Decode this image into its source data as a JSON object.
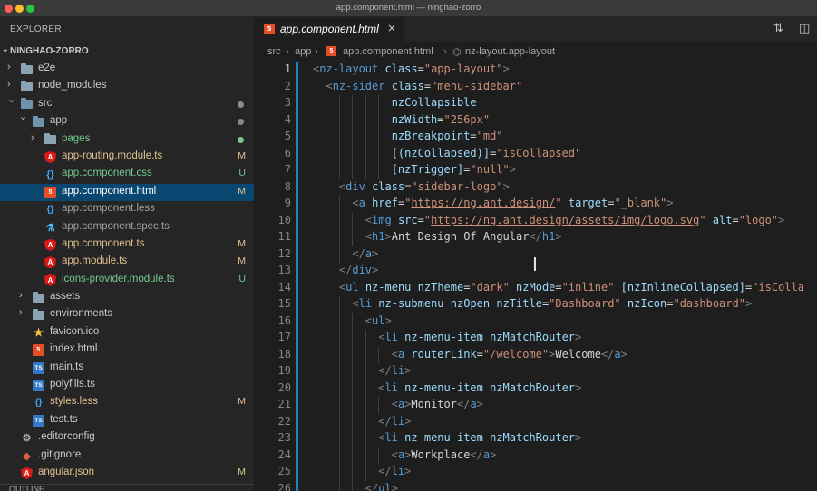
{
  "window": {
    "title": "app.component.html — ninghao-zorro"
  },
  "sidebar": {
    "title": "EXPLORER",
    "project": "NINGHAO-ZORRO",
    "outline_label": "OUTLINE",
    "tree": [
      {
        "name": "e2e",
        "kind": "folder",
        "open": false,
        "depth": 0
      },
      {
        "name": "node_modules",
        "kind": "folder",
        "open": false,
        "depth": 0
      },
      {
        "name": "src",
        "kind": "folder",
        "open": true,
        "depth": 0,
        "dot": "#8a8a8a",
        "name_color": "#cccccc"
      },
      {
        "name": "app",
        "kind": "folder",
        "open": true,
        "depth": 1,
        "dot": "#8a8a8a"
      },
      {
        "name": "pages",
        "kind": "folder",
        "open": false,
        "depth": 2,
        "dot": "#73c991",
        "name_color": "#73c991"
      },
      {
        "name": "app-routing.module.ts",
        "kind": "angular",
        "depth": 2,
        "status": "M",
        "name_color": "#e2c08d"
      },
      {
        "name": "app.component.css",
        "kind": "css",
        "depth": 2,
        "status": "U",
        "name_color": "#73c991"
      },
      {
        "name": "app.component.html",
        "kind": "html",
        "depth": 2,
        "status": "M",
        "selected": true,
        "name_color": "#ffffff"
      },
      {
        "name": "app.component.less",
        "kind": "less",
        "depth": 2,
        "name_color": "#a0a0a0"
      },
      {
        "name": "app.component.spec.ts",
        "kind": "spec",
        "depth": 2,
        "name_color": "#a0a0a0"
      },
      {
        "name": "app.component.ts",
        "kind": "angular",
        "depth": 2,
        "status": "M",
        "name_color": "#e2c08d"
      },
      {
        "name": "app.module.ts",
        "kind": "angular",
        "depth": 2,
        "status": "M",
        "name_color": "#e2c08d"
      },
      {
        "name": "icons-provider.module.ts",
        "kind": "angular",
        "depth": 2,
        "status": "U",
        "name_color": "#73c991"
      },
      {
        "name": "assets",
        "kind": "folder",
        "open": false,
        "depth": 1
      },
      {
        "name": "environments",
        "kind": "folder",
        "open": false,
        "depth": 1
      },
      {
        "name": "favicon.ico",
        "kind": "star",
        "depth": 1
      },
      {
        "name": "index.html",
        "kind": "html",
        "depth": 1
      },
      {
        "name": "main.ts",
        "kind": "ts",
        "depth": 1
      },
      {
        "name": "polyfills.ts",
        "kind": "ts",
        "depth": 1
      },
      {
        "name": "styles.less",
        "kind": "less",
        "depth": 1,
        "status": "M",
        "name_color": "#e2c08d"
      },
      {
        "name": "test.ts",
        "kind": "ts",
        "depth": 1
      },
      {
        "name": ".editorconfig",
        "kind": "editor",
        "depth": 0
      },
      {
        "name": ".gitignore",
        "kind": "git",
        "depth": 0
      },
      {
        "name": "angular.json",
        "kind": "angular",
        "depth": 0,
        "status": "M",
        "name_color": "#e2c08d"
      }
    ]
  },
  "editor": {
    "tab": {
      "label": "app.component.html",
      "close": "×"
    },
    "breadcrumb": [
      "src",
      "app",
      "app.component.html",
      "nz-layout.app-layout"
    ],
    "lines": [
      [
        [
          "t-punc",
          "<"
        ],
        [
          "t-tag",
          "nz-layout"
        ],
        [
          "t-text",
          " "
        ],
        [
          "t-attr",
          "class"
        ],
        [
          "t-eq",
          "="
        ],
        [
          "t-str",
          "\"app-layout\""
        ],
        [
          "t-punc",
          ">"
        ]
      ],
      [
        [
          "t-text",
          "  "
        ],
        [
          "t-punc",
          "<"
        ],
        [
          "t-tag",
          "nz-sider"
        ],
        [
          "t-text",
          " "
        ],
        [
          "t-attr",
          "class"
        ],
        [
          "t-eq",
          "="
        ],
        [
          "t-str",
          "\"menu-sidebar\""
        ]
      ],
      [
        [
          "t-text",
          "            "
        ],
        [
          "t-attr",
          "nzCollapsible"
        ]
      ],
      [
        [
          "t-text",
          "            "
        ],
        [
          "t-attr",
          "nzWidth"
        ],
        [
          "t-eq",
          "="
        ],
        [
          "t-str",
          "\"256px\""
        ]
      ],
      [
        [
          "t-text",
          "            "
        ],
        [
          "t-attr",
          "nzBreakpoint"
        ],
        [
          "t-eq",
          "="
        ],
        [
          "t-str",
          "\"md\""
        ]
      ],
      [
        [
          "t-text",
          "            "
        ],
        [
          "t-attr",
          "[(nzCollapsed)]"
        ],
        [
          "t-eq",
          "="
        ],
        [
          "t-str",
          "\"isCollapsed\""
        ]
      ],
      [
        [
          "t-text",
          "            "
        ],
        [
          "t-attr",
          "[nzTrigger]"
        ],
        [
          "t-eq",
          "="
        ],
        [
          "t-str",
          "\"null\""
        ],
        [
          "t-punc",
          ">"
        ]
      ],
      [
        [
          "t-text",
          "    "
        ],
        [
          "t-punc",
          "<"
        ],
        [
          "t-tag",
          "div"
        ],
        [
          "t-text",
          " "
        ],
        [
          "t-attr",
          "class"
        ],
        [
          "t-eq",
          "="
        ],
        [
          "t-str",
          "\"sidebar-logo\""
        ],
        [
          "t-punc",
          ">"
        ]
      ],
      [
        [
          "t-text",
          "      "
        ],
        [
          "t-punc",
          "<"
        ],
        [
          "t-tag",
          "a"
        ],
        [
          "t-text",
          " "
        ],
        [
          "t-attr",
          "href"
        ],
        [
          "t-eq",
          "="
        ],
        [
          "t-str",
          "\""
        ],
        [
          "t-url",
          "https://ng.ant.design/"
        ],
        [
          "t-str",
          "\""
        ],
        [
          "t-text",
          " "
        ],
        [
          "t-attr",
          "target"
        ],
        [
          "t-eq",
          "="
        ],
        [
          "t-str",
          "\"_blank\""
        ],
        [
          "t-punc",
          ">"
        ]
      ],
      [
        [
          "t-text",
          "        "
        ],
        [
          "t-punc",
          "<"
        ],
        [
          "t-tag",
          "img"
        ],
        [
          "t-text",
          " "
        ],
        [
          "t-attr",
          "src"
        ],
        [
          "t-eq",
          "="
        ],
        [
          "t-str",
          "\""
        ],
        [
          "t-url",
          "https://ng.ant.design/assets/img/logo.svg"
        ],
        [
          "t-str",
          "\""
        ],
        [
          "t-text",
          " "
        ],
        [
          "t-attr",
          "alt"
        ],
        [
          "t-eq",
          "="
        ],
        [
          "t-str",
          "\"logo\""
        ],
        [
          "t-punc",
          ">"
        ]
      ],
      [
        [
          "t-text",
          "        "
        ],
        [
          "t-punc",
          "<"
        ],
        [
          "t-tag",
          "h1"
        ],
        [
          "t-punc",
          ">"
        ],
        [
          "t-text",
          "Ant Design Of Angular"
        ],
        [
          "t-punc",
          "</"
        ],
        [
          "t-tag",
          "h1"
        ],
        [
          "t-punc",
          ">"
        ]
      ],
      [
        [
          "t-text",
          "      "
        ],
        [
          "t-punc",
          "</"
        ],
        [
          "t-tag",
          "a"
        ],
        [
          "t-punc",
          ">"
        ]
      ],
      [
        [
          "t-text",
          "    "
        ],
        [
          "t-punc",
          "</"
        ],
        [
          "t-tag",
          "div"
        ],
        [
          "t-punc",
          ">"
        ]
      ],
      [
        [
          "t-text",
          "    "
        ],
        [
          "t-punc",
          "<"
        ],
        [
          "t-tag",
          "ul"
        ],
        [
          "t-text",
          " "
        ],
        [
          "t-attr",
          "nz-menu"
        ],
        [
          "t-text",
          " "
        ],
        [
          "t-attr",
          "nzTheme"
        ],
        [
          "t-eq",
          "="
        ],
        [
          "t-str",
          "\"dark\""
        ],
        [
          "t-text",
          " "
        ],
        [
          "t-attr",
          "nzMode"
        ],
        [
          "t-eq",
          "="
        ],
        [
          "t-str",
          "\"inline\""
        ],
        [
          "t-text",
          " "
        ],
        [
          "t-attr",
          "[nzInlineCollapsed]"
        ],
        [
          "t-eq",
          "="
        ],
        [
          "t-str",
          "\"isColla"
        ]
      ],
      [
        [
          "t-text",
          "      "
        ],
        [
          "t-punc",
          "<"
        ],
        [
          "t-tag",
          "li"
        ],
        [
          "t-text",
          " "
        ],
        [
          "t-attr",
          "nz-submenu"
        ],
        [
          "t-text",
          " "
        ],
        [
          "t-attr",
          "nzOpen"
        ],
        [
          "t-text",
          " "
        ],
        [
          "t-attr",
          "nzTitle"
        ],
        [
          "t-eq",
          "="
        ],
        [
          "t-str",
          "\"Dashboard\""
        ],
        [
          "t-text",
          " "
        ],
        [
          "t-attr",
          "nzIcon"
        ],
        [
          "t-eq",
          "="
        ],
        [
          "t-str",
          "\"dashboard\""
        ],
        [
          "t-punc",
          ">"
        ]
      ],
      [
        [
          "t-text",
          "        "
        ],
        [
          "t-punc",
          "<"
        ],
        [
          "t-tag",
          "ul"
        ],
        [
          "t-punc",
          ">"
        ]
      ],
      [
        [
          "t-text",
          "          "
        ],
        [
          "t-punc",
          "<"
        ],
        [
          "t-tag",
          "li"
        ],
        [
          "t-text",
          " "
        ],
        [
          "t-attr",
          "nz-menu-item"
        ],
        [
          "t-text",
          " "
        ],
        [
          "t-attr",
          "nzMatchRouter"
        ],
        [
          "t-punc",
          ">"
        ]
      ],
      [
        [
          "t-text",
          "            "
        ],
        [
          "t-punc",
          "<"
        ],
        [
          "t-tag",
          "a"
        ],
        [
          "t-text",
          " "
        ],
        [
          "t-attr",
          "routerLink"
        ],
        [
          "t-eq",
          "="
        ],
        [
          "t-str",
          "\"/welcome\""
        ],
        [
          "t-punc",
          ">"
        ],
        [
          "t-text",
          "Welcome"
        ],
        [
          "t-punc",
          "</"
        ],
        [
          "t-tag",
          "a"
        ],
        [
          "t-punc",
          ">"
        ]
      ],
      [
        [
          "t-text",
          "          "
        ],
        [
          "t-punc",
          "</"
        ],
        [
          "t-tag",
          "li"
        ],
        [
          "t-punc",
          ">"
        ]
      ],
      [
        [
          "t-text",
          "          "
        ],
        [
          "t-punc",
          "<"
        ],
        [
          "t-tag",
          "li"
        ],
        [
          "t-text",
          " "
        ],
        [
          "t-attr",
          "nz-menu-item"
        ],
        [
          "t-text",
          " "
        ],
        [
          "t-attr",
          "nzMatchRouter"
        ],
        [
          "t-punc",
          ">"
        ]
      ],
      [
        [
          "t-text",
          "            "
        ],
        [
          "t-punc",
          "<"
        ],
        [
          "t-tag",
          "a"
        ],
        [
          "t-punc",
          ">"
        ],
        [
          "t-text",
          "Monitor"
        ],
        [
          "t-punc",
          "</"
        ],
        [
          "t-tag",
          "a"
        ],
        [
          "t-punc",
          ">"
        ]
      ],
      [
        [
          "t-text",
          "          "
        ],
        [
          "t-punc",
          "</"
        ],
        [
          "t-tag",
          "li"
        ],
        [
          "t-punc",
          ">"
        ]
      ],
      [
        [
          "t-text",
          "          "
        ],
        [
          "t-punc",
          "<"
        ],
        [
          "t-tag",
          "li"
        ],
        [
          "t-text",
          " "
        ],
        [
          "t-attr",
          "nz-menu-item"
        ],
        [
          "t-text",
          " "
        ],
        [
          "t-attr",
          "nzMatchRouter"
        ],
        [
          "t-punc",
          ">"
        ]
      ],
      [
        [
          "t-text",
          "            "
        ],
        [
          "t-punc",
          "<"
        ],
        [
          "t-tag",
          "a"
        ],
        [
          "t-punc",
          ">"
        ],
        [
          "t-text",
          "Workplace"
        ],
        [
          "t-punc",
          "</"
        ],
        [
          "t-tag",
          "a"
        ],
        [
          "t-punc",
          ">"
        ]
      ],
      [
        [
          "t-text",
          "          "
        ],
        [
          "t-punc",
          "</"
        ],
        [
          "t-tag",
          "li"
        ],
        [
          "t-punc",
          ">"
        ]
      ],
      [
        [
          "t-text",
          "        "
        ],
        [
          "t-punc",
          "</"
        ],
        [
          "t-tag",
          "ul"
        ],
        [
          "t-punc",
          ">"
        ]
      ]
    ],
    "first_line_number": 1,
    "active_line": 1
  },
  "colors": {
    "selection": "#094771",
    "modified": "#e2c08d",
    "untracked": "#73c991",
    "accent": "#1f8dd6"
  }
}
